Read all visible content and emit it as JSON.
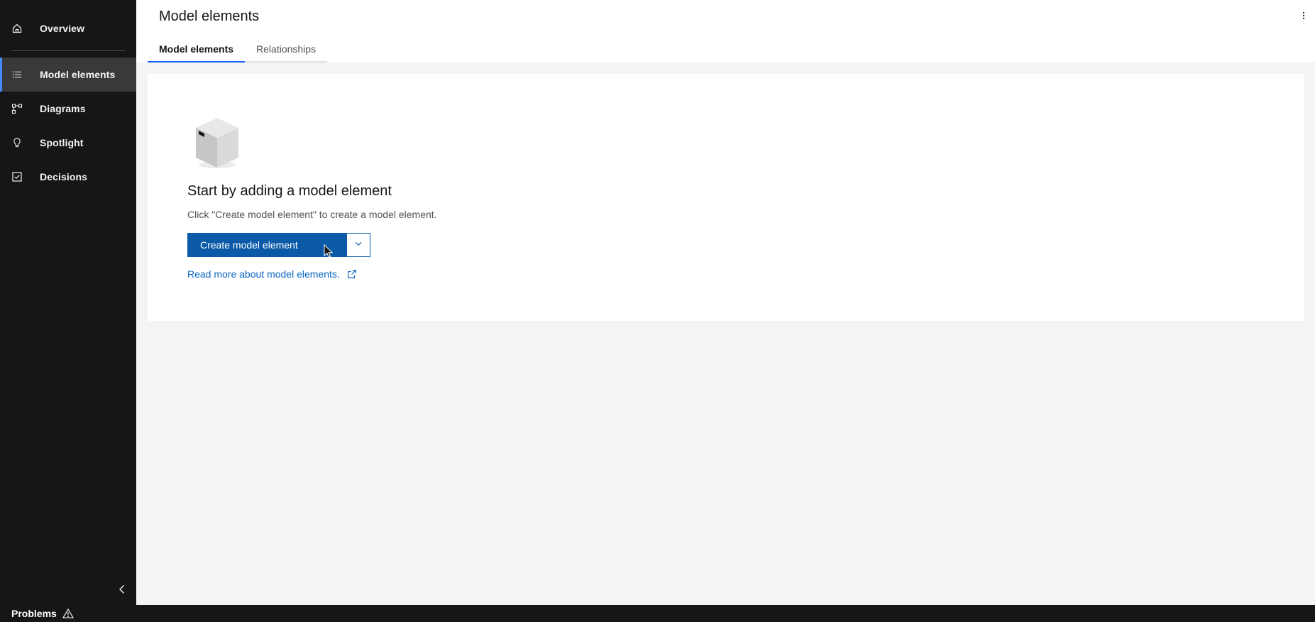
{
  "sidebar": {
    "items": [
      {
        "label": "Overview",
        "icon": "home-icon"
      },
      {
        "label": "Model elements",
        "icon": "list-icon",
        "active": true
      },
      {
        "label": "Diagrams",
        "icon": "diagram-icon"
      },
      {
        "label": "Spotlight",
        "icon": "lightbulb-icon"
      },
      {
        "label": "Decisions",
        "icon": "checkbox-checked-icon"
      }
    ],
    "collapse_icon": "chevron-left-icon"
  },
  "header": {
    "title": "Model elements",
    "overflow_icon": "overflow-menu-vertical-icon",
    "tabs": [
      {
        "label": "Model elements",
        "active": true
      },
      {
        "label": "Relationships",
        "active": false
      }
    ]
  },
  "empty_state": {
    "illustration": "box-icon",
    "title": "Start by adding a model element",
    "description": "Click \"Create model element\" to create a model element.",
    "primary_button": "Create model element",
    "caret_icon": "chevron-down-icon",
    "link": "Read more about model elements.",
    "link_icon": "launch-icon"
  },
  "statusbar": {
    "problems_label": "Problems",
    "problems_icon": "warning-icon"
  },
  "colors": {
    "sidebar_bg": "#161616",
    "active_item_bg": "#393939",
    "accent": "#4589ff",
    "primary_button": "#0a5aa8",
    "link": "#0a66c2",
    "tab_active_underline": "#0f62fe"
  }
}
